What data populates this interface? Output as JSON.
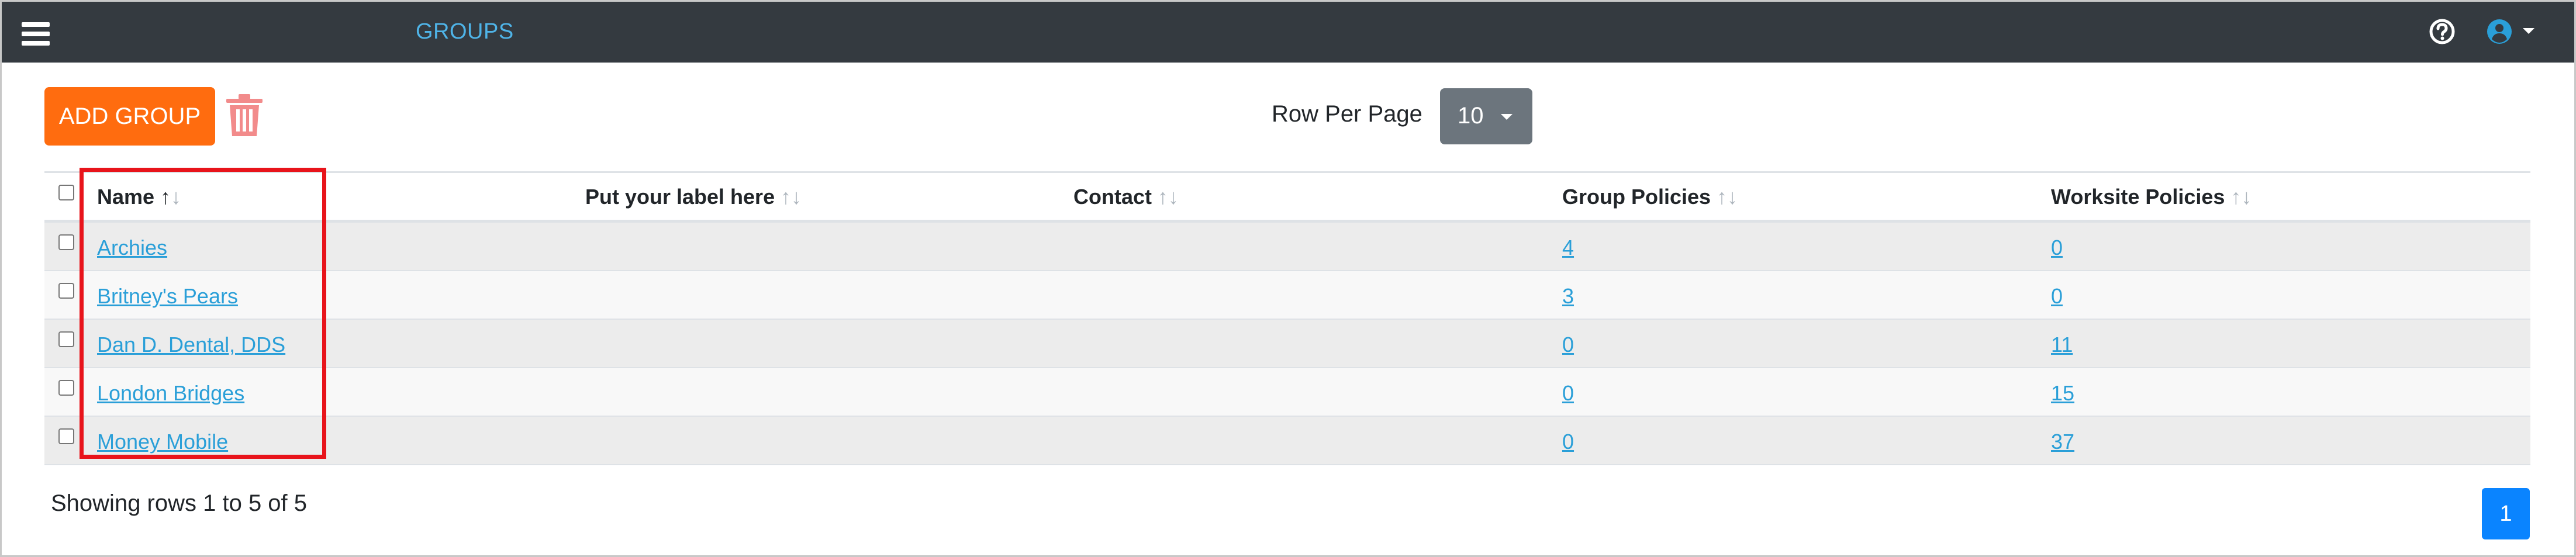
{
  "navbar": {
    "title": "GROUPS",
    "menu_icon": "hamburger-icon",
    "help_icon": "help-circle-icon",
    "user_icon": "user-circle-icon"
  },
  "toolbar": {
    "add_label": "ADD GROUP",
    "delete_icon": "trash-icon",
    "rows_per_page_label": "Row Per Page",
    "rows_per_page_value": "10"
  },
  "table": {
    "columns": [
      "Name",
      "Put your label here",
      "Contact",
      "Group Policies",
      "Worksite Policies"
    ],
    "rows": [
      {
        "name": "Archies",
        "label": "",
        "contact": "",
        "group_policies": "4",
        "worksite_policies": "0"
      },
      {
        "name": "Britney's Pears",
        "label": "",
        "contact": "",
        "group_policies": "3",
        "worksite_policies": "0"
      },
      {
        "name": "Dan D. Dental, DDS",
        "label": "",
        "contact": "",
        "group_policies": "0",
        "worksite_policies": "11"
      },
      {
        "name": "London Bridges",
        "label": "",
        "contact": "",
        "group_policies": "0",
        "worksite_policies": "15"
      },
      {
        "name": "Money Mobile",
        "label": "",
        "contact": "",
        "group_policies": "0",
        "worksite_policies": "37"
      }
    ]
  },
  "footer": {
    "showing_text": "Showing rows 1 to 5 of 5",
    "current_page": "1"
  },
  "colors": {
    "navbar": "#343a40",
    "accent": "#ff6c0f",
    "link": "#2a9fd8",
    "page_button": "#0a84ff",
    "highlight": "#e8141b"
  }
}
